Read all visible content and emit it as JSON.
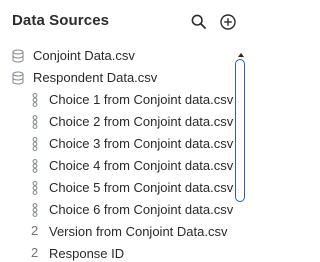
{
  "header": {
    "title": "Data Sources",
    "search_icon": "search-icon",
    "add_icon": "add-circle-icon"
  },
  "tree": {
    "items": [
      {
        "label": "Conjoint Data.csv",
        "icon": "database-icon",
        "level": 0
      },
      {
        "label": "Respondent Data.csv",
        "icon": "database-icon",
        "level": 0
      },
      {
        "label": "Choice 1 from Conjoint data.csv",
        "icon": "nominal-variable-icon",
        "level": 1
      },
      {
        "label": "Choice 2 from Conjoint data.csv",
        "icon": "nominal-variable-icon",
        "level": 1
      },
      {
        "label": "Choice 3 from Conjoint data.csv",
        "icon": "nominal-variable-icon",
        "level": 1
      },
      {
        "label": "Choice 4 from Conjoint data.csv",
        "icon": "nominal-variable-icon",
        "level": 1
      },
      {
        "label": "Choice 5 from Conjoint data.csv",
        "icon": "nominal-variable-icon",
        "level": 1
      },
      {
        "label": "Choice 6 from Conjoint data.csv",
        "icon": "nominal-variable-icon",
        "level": 1
      },
      {
        "label": "Version from Conjoint Data.csv",
        "icon": "numeric-variable-icon",
        "icon_text": "2",
        "level": 1
      },
      {
        "label": "Response ID",
        "icon": "numeric-variable-icon",
        "icon_text": "2",
        "level": 1
      }
    ]
  },
  "colors": {
    "accent": "#2f5fa6",
    "icon_gray": "#8a8f93",
    "text": "#2a2a2a"
  }
}
